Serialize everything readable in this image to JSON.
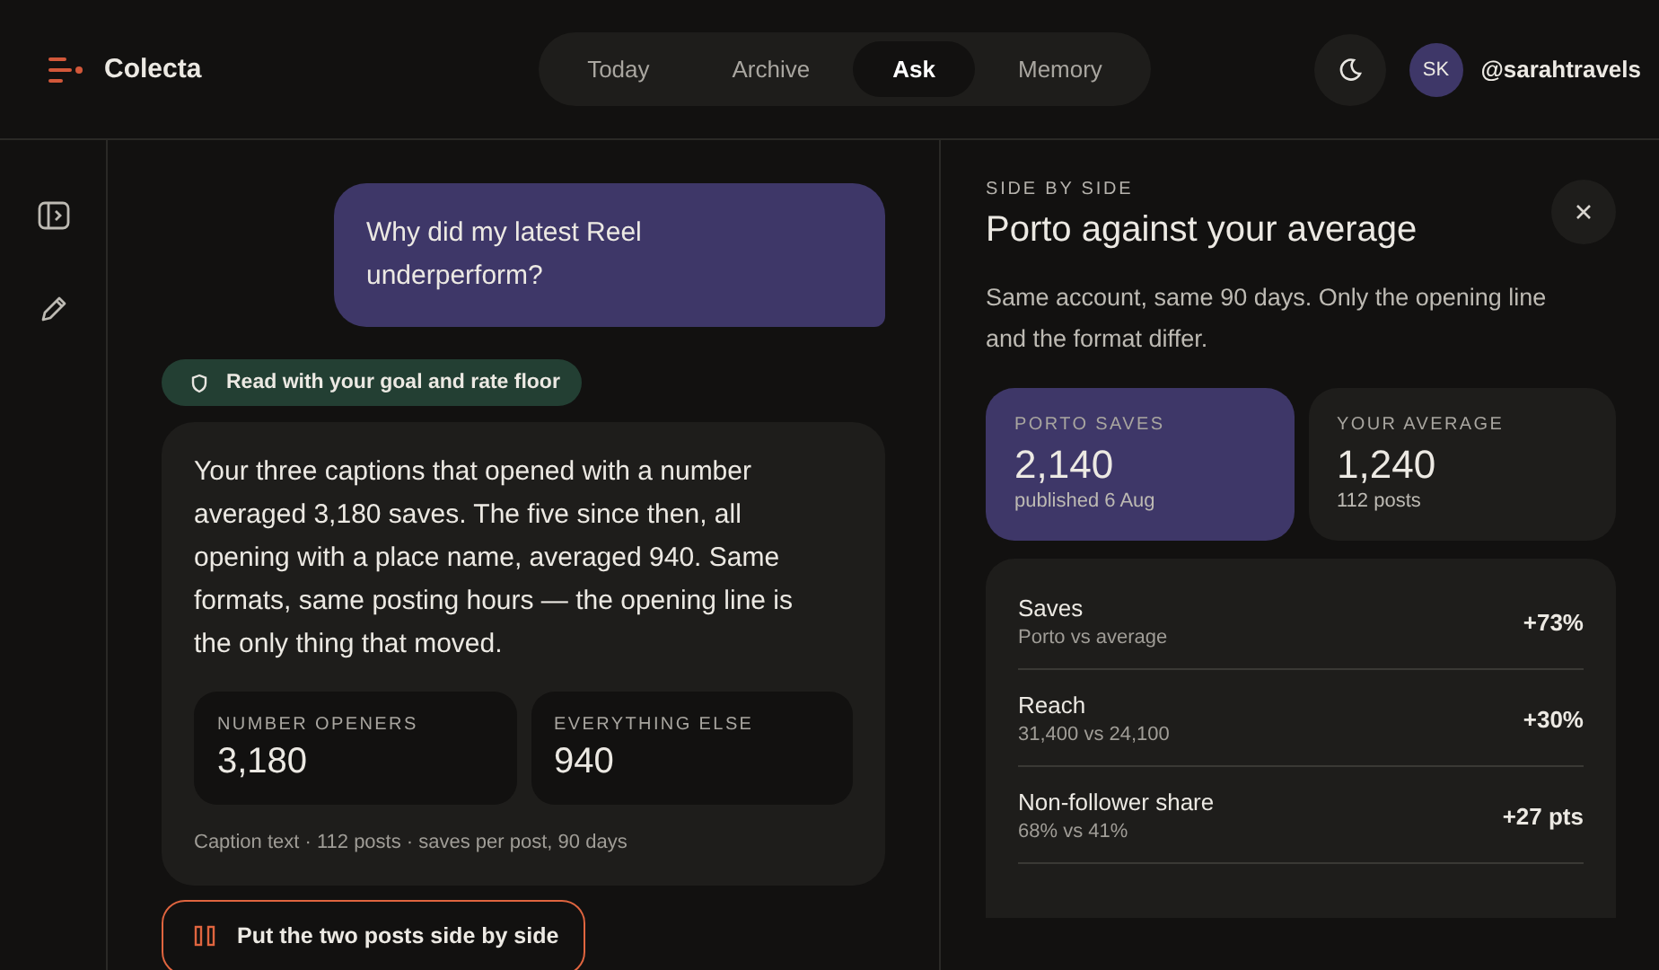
{
  "brand": {
    "name": "Colecta"
  },
  "tabs": [
    {
      "label": "Today",
      "selected": false
    },
    {
      "label": "Archive",
      "selected": false
    },
    {
      "label": "Ask",
      "selected": true
    },
    {
      "label": "Memory",
      "selected": false
    }
  ],
  "user": {
    "initials": "SK",
    "handle": "@sarahtravels"
  },
  "chat": {
    "question": "Why did my latest Reel underperform?",
    "context_chip": "Read with your goal and rate floor",
    "answer": "Your three captions that opened with a number averaged 3,180 saves. The five since then, all opening with a place name, averaged 940. Same formats, same posting hours — the opening line is the only thing that moved.",
    "stats": [
      {
        "label": "NUMBER OPENERS",
        "value": "3,180"
      },
      {
        "label": "EVERYTHING ELSE",
        "value": "940"
      }
    ],
    "source": "Caption text · 112 posts · saves per post, 90 days",
    "action": "Put the two posts side by side"
  },
  "panel": {
    "eyebrow": "SIDE BY SIDE",
    "title": "Porto against your average",
    "description": "Same account, same 90 days. Only the opening line and the format differ.",
    "cards": [
      {
        "label": "PORTO SAVES",
        "value": "2,140",
        "note": "published 6 Aug",
        "selected": true
      },
      {
        "label": "YOUR AVERAGE",
        "value": "1,240",
        "note": "112 posts",
        "selected": false
      }
    ],
    "rows": [
      {
        "name": "Saves",
        "detail": "Porto vs average",
        "delta": "+73%"
      },
      {
        "name": "Reach",
        "detail": "31,400 vs 24,100",
        "delta": "+30%"
      },
      {
        "name": "Non-follower share",
        "detail": "68% vs 41%",
        "delta": "+27 pts"
      }
    ]
  }
}
